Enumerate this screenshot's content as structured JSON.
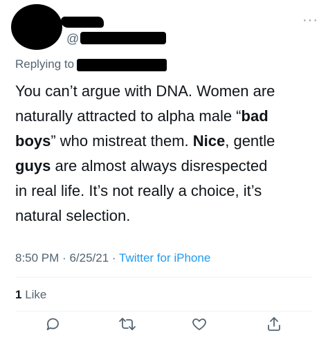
{
  "tweet": {
    "handle_prefix": "@",
    "more_label": "···",
    "replying_to_label": "Replying to",
    "text_lines": [
      "You can’t argue with DNA. Women are",
      "naturally attracted to alpha male  “bad",
      "boys” who mistreat them. Nice, gentle",
      "guys are almost always disrespected",
      "in real life. It’s not really a choice, it’s",
      "natural selection."
    ],
    "time": "8:50 PM",
    "date": "6/25/21",
    "separator": "·",
    "source": "Twitter for iPhone",
    "like_count": "1",
    "like_label": "Like"
  },
  "colors": {
    "text": "#0f1419",
    "secondary": "#536471",
    "link": "#1d9bf0",
    "divider": "#eff3f4"
  },
  "icons": [
    "more-icon",
    "reply-icon",
    "retweet-icon",
    "like-icon",
    "share-icon"
  ]
}
